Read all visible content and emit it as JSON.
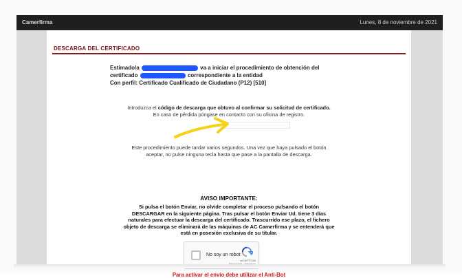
{
  "topbar": {
    "brand": "Camerfirma",
    "date": "Lunes, 8 de noviembre de 2021"
  },
  "section": {
    "title": "Descarga del certificado"
  },
  "intro": {
    "line1_a": "Estimado/a",
    "line1_b": "va a iniciar el procedimiento de obtención del",
    "line2_a": "certificado",
    "line2_b": "correspondiente a la entidad",
    "line3": "Con perfil: Certificado Cualificado de Ciudadano (P12) [510]"
  },
  "instructions": {
    "line1_a": "Introduzca el ",
    "line1_b": "código de descarga que obtuvo al confirmar su solicitud de certificado.",
    "line2": "En caso de pérdida póngase en contacto con su oficina de registro."
  },
  "procedure": {
    "line1": "Este procedimiento puede tardar varios segundos. Una vez que haya pulsado el botón",
    "line2": "aceptar, no pulse ninguna tecla hasta que pase a la pantalla de descarga."
  },
  "notice": {
    "title": "AVISO IMPORTANTE:",
    "body": "Si pulsa el botón Enviar, no olvide completar el proceso pulsando el botón DESCARGAR en la siguiente página. Tras pulsar el botón Enviar Ud. tiene 3 días naturales para efectuar la descarga del certificado. Trascurrido ese plazo, el fichero objeto de descarga se eliminará de las máquinas de AC Camerfirma y se entenderá que está en posesión exclusiva de su titular."
  },
  "captcha": {
    "label": "No soy un robot",
    "brand": "reCAPTCHA",
    "links": "Privacidad - Términos"
  },
  "warning": "Para activar el envío debe utilizar el Anti-Bot",
  "colors": {
    "accent": "#8b1a1a",
    "warning": "#d01515",
    "redaction": "#1d57ff",
    "arrow": "#f4d21a"
  }
}
